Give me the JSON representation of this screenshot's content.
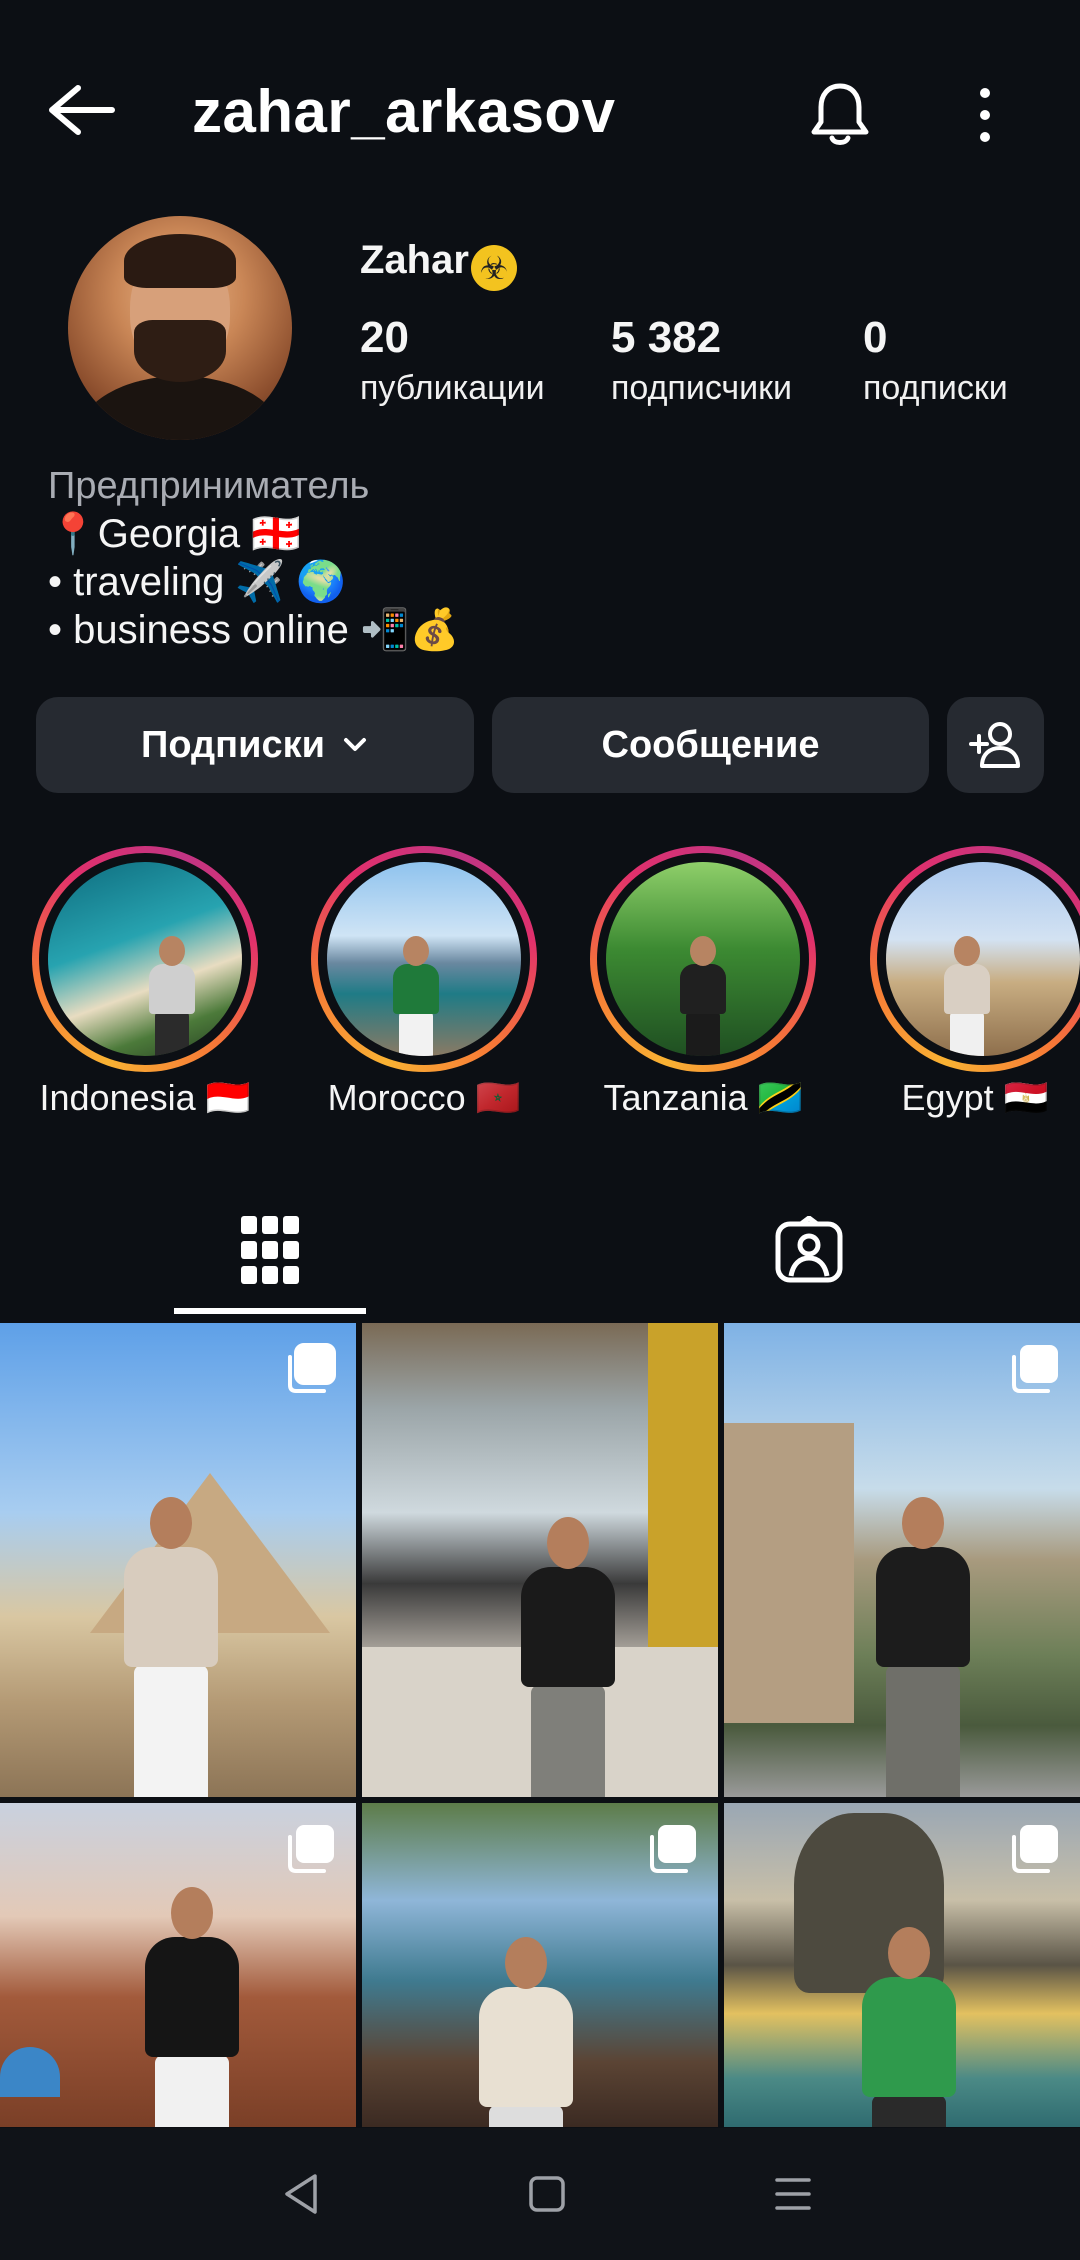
{
  "header": {
    "username": "zahar_arkasov",
    "icons": [
      "back-arrow-icon",
      "bell-icon",
      "more-vertical-icon"
    ]
  },
  "profile": {
    "display_name": "Zahar",
    "name_badge": "☣",
    "stats": [
      {
        "value": "20",
        "label": "публикации"
      },
      {
        "value": "5 382",
        "label": "подписчики"
      },
      {
        "value": "0",
        "label": "подписки"
      }
    ]
  },
  "bio": {
    "category": "Предприниматель",
    "lines": [
      "📍Georgia 🇬🇪",
      "• traveling ✈️ 🌍",
      "• business online 📲💰"
    ]
  },
  "actions": {
    "following_label": "Подписки",
    "message_label": "Сообщение"
  },
  "highlights": [
    {
      "label": "Indonesia 🇮🇩"
    },
    {
      "label": "Morocco 🇲🇦"
    },
    {
      "label": "Tanzania 🇹🇿"
    },
    {
      "label": "Egypt 🇪🇬"
    }
  ],
  "tabs": [
    "grid-icon",
    "tagged-icon"
  ],
  "colors": {
    "background": "#0c0f14",
    "button": "#262a31",
    "story_ring_start": "#f9b233",
    "story_ring_end": "#c13584"
  }
}
